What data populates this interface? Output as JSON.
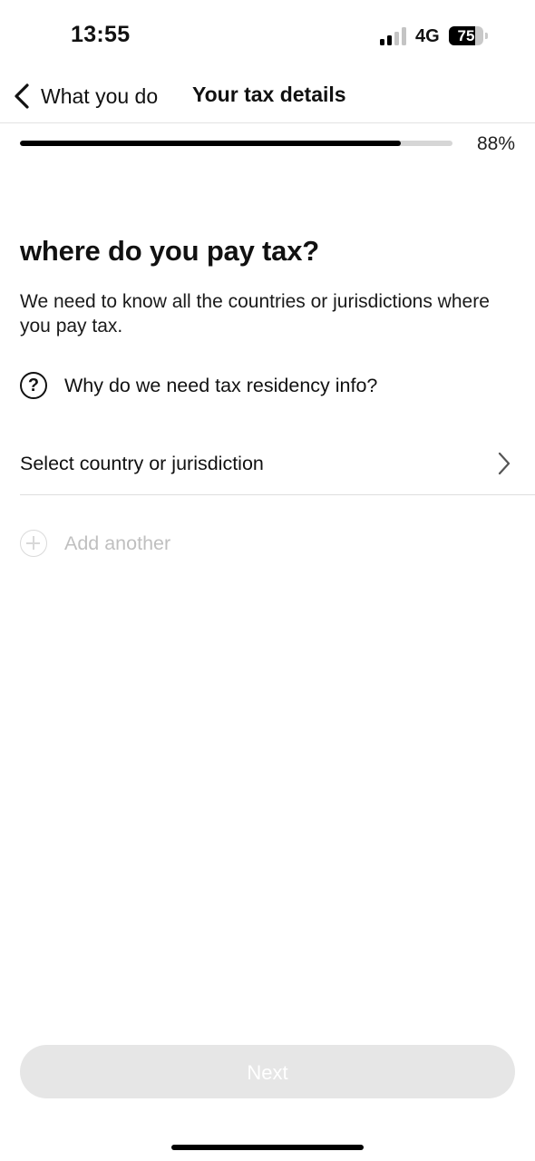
{
  "status_bar": {
    "time": "13:55",
    "network": "4G",
    "battery": "75",
    "battery_level": 0.75,
    "signal_bars_active": 2,
    "signal_bars_total": 4
  },
  "nav": {
    "back_label": "What you do",
    "title": "Your tax details"
  },
  "progress": {
    "label": "88%",
    "value": 0.88
  },
  "content": {
    "heading": "where do you pay tax?",
    "description": "We need to know all the countries or jurisdictions where you pay tax.",
    "help_link": "Why do we need tax residency info?",
    "help_icon_glyph": "?",
    "country_select": "Select country or jurisdiction",
    "add_another": "Add another"
  },
  "footer": {
    "next_label": "Next",
    "next_enabled": false
  },
  "colors": {
    "text": "#111111",
    "progress_fill": "#000000",
    "progress_track": "#d6d6d6",
    "disabled_button": "#e6e6e6",
    "disabled_text": "#bfbfbf"
  },
  "icons": [
    "chevron-left-icon",
    "question-circle-icon",
    "chevron-right-icon",
    "plus-circle-icon",
    "signal-icon",
    "battery-icon"
  ]
}
